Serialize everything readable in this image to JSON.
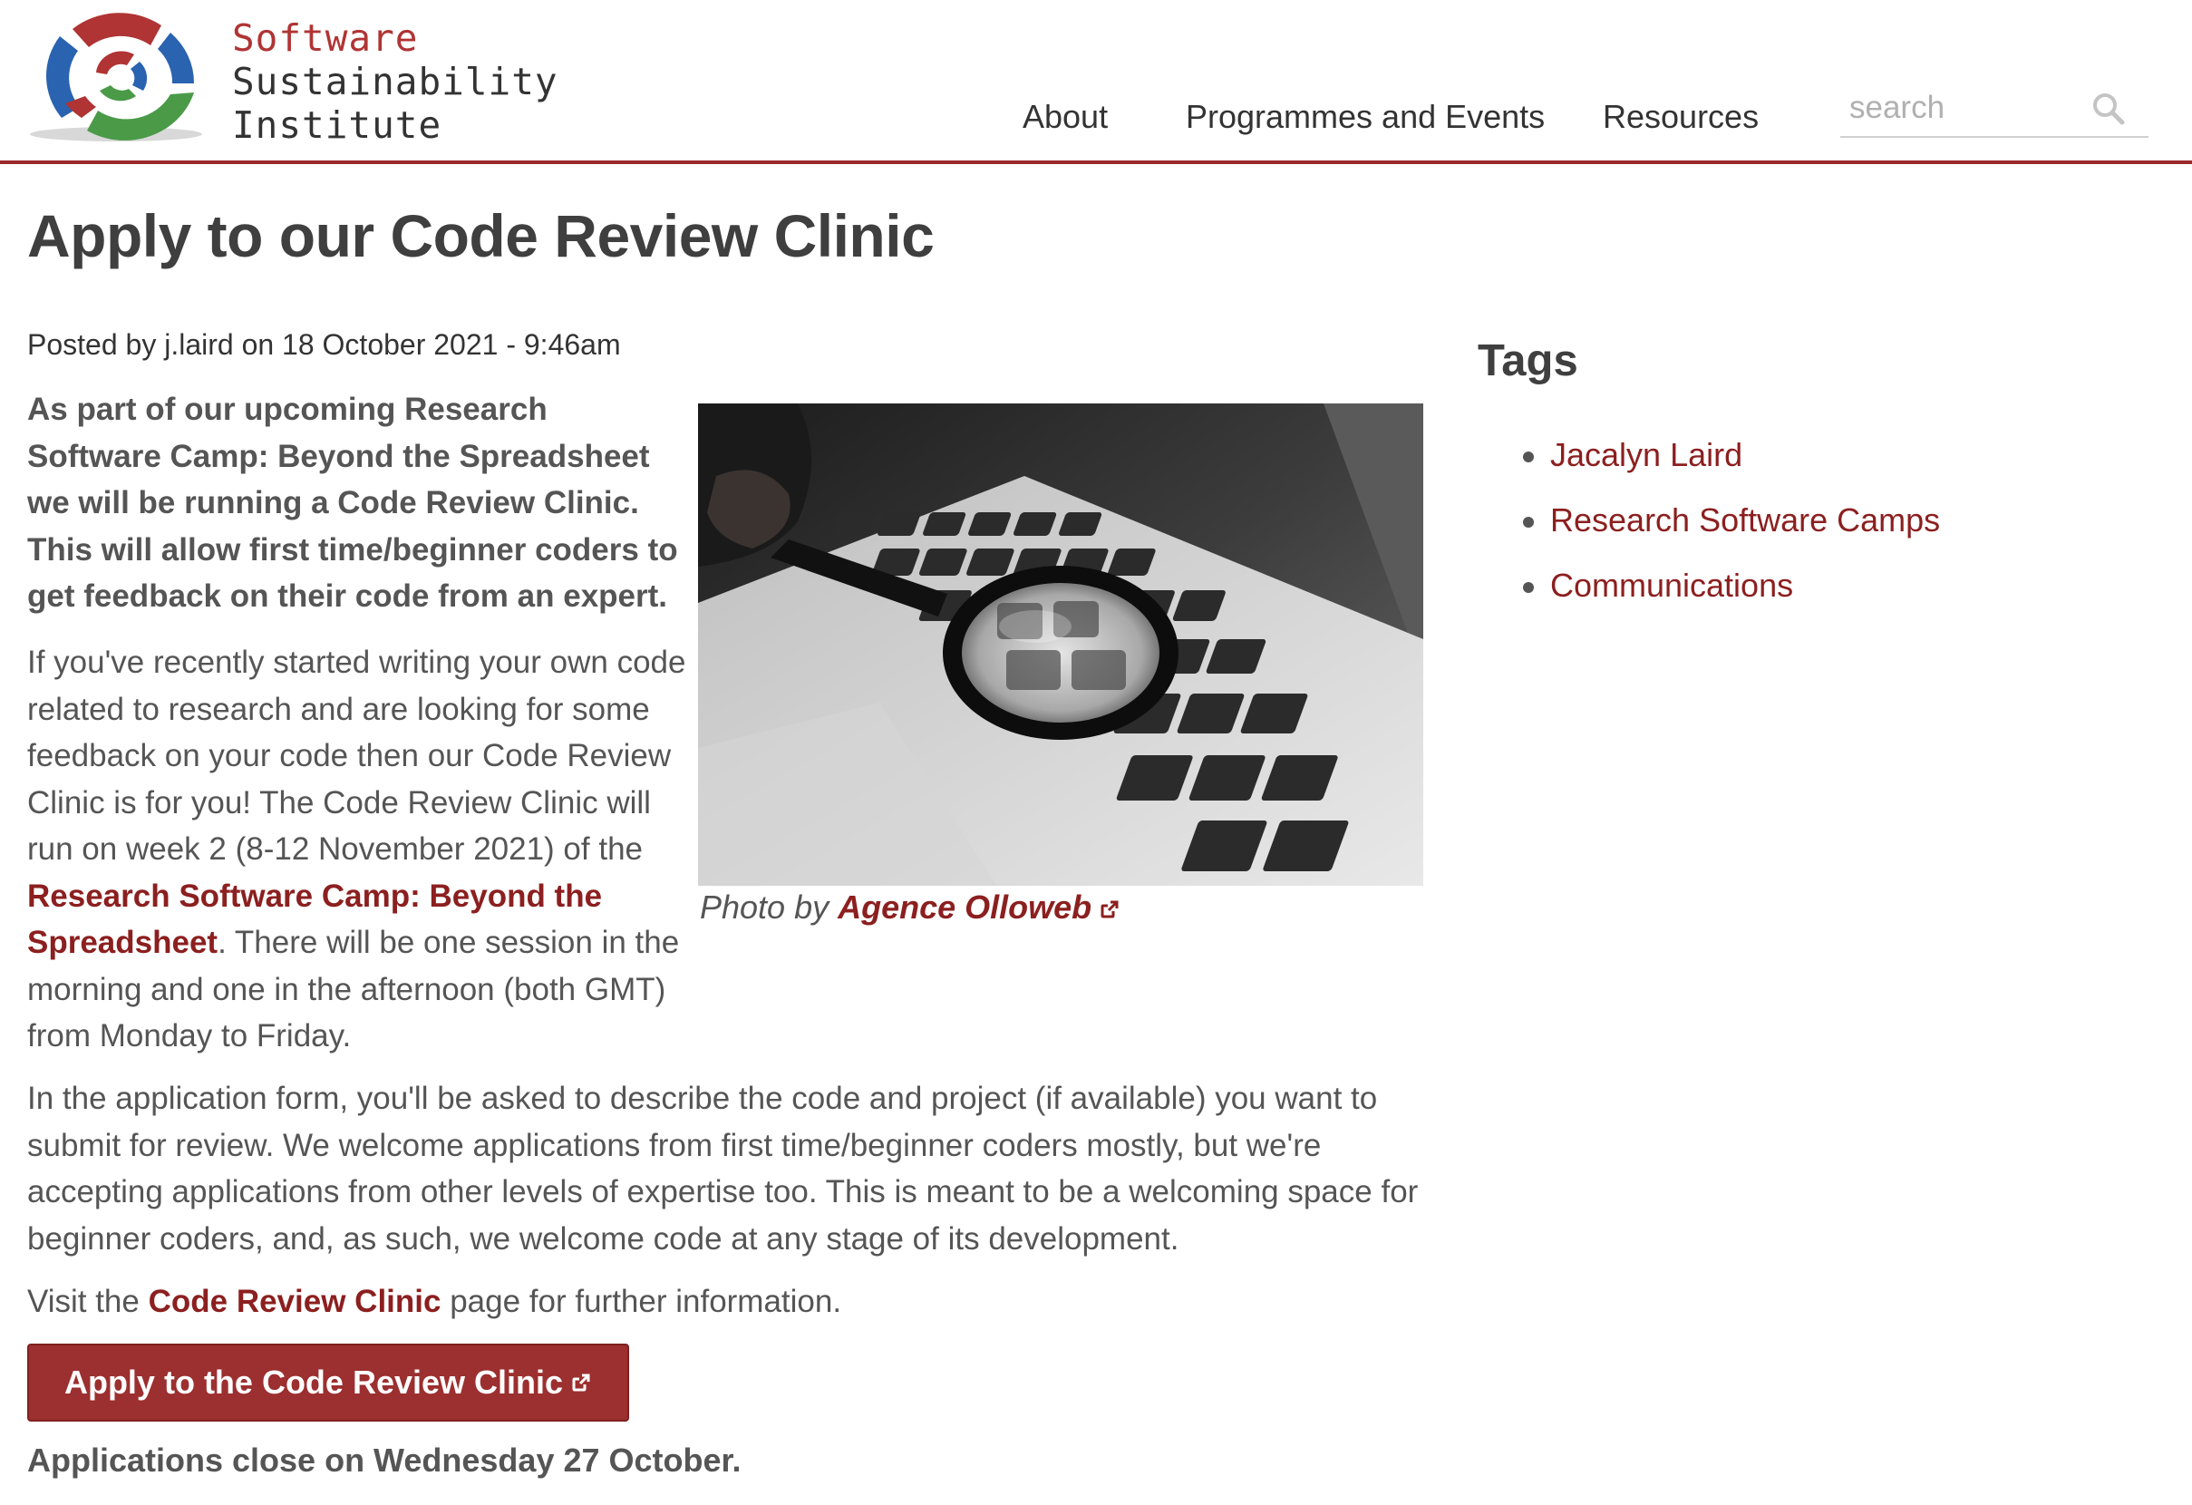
{
  "site": {
    "logo_lines": [
      "Software",
      "Sustainability",
      "Institute"
    ],
    "nav": [
      "About",
      "Programmes and Events",
      "Resources"
    ],
    "search_placeholder": "search"
  },
  "article": {
    "title": "Apply to our Code Review Clinic",
    "meta": "Posted by j.laird on 18 October 2021 - 9:46am",
    "lead": "As part of our upcoming Research Software Camp: Beyond the Spreadsheet we will be running a Code Review Clinic. This will allow first time/beginner coders to get feedback on their code from an expert.",
    "para1_before": "If you've recently started writing your own code related to research and are looking for some feedback on your code then our Code Review Clinic is for you! The Code Review Clinic will run on week 2 (8-12 November 2021) of the ",
    "para1_link": "Research Software Camp: Beyond the Spreadsheet",
    "para1_after": ". There will be one session in the morning and one in the afternoon (both GMT) from Monday to Friday.",
    "para2": "In the application form, you'll be asked to describe the code and project (if available) you want to submit for review. We welcome applications from first time/beginner coders mostly, but we're accepting applications from other levels of expertise too. This is meant to be a welcoming space for beginner coders, and, as such, we welcome code at any stage of its development.",
    "para3_before": "Visit the ",
    "para3_link": "Code Review Clinic",
    "para3_after": " page for further information.",
    "caption_prefix": "Photo by ",
    "caption_link": "Agence Olloweb",
    "apply_button": "Apply to the Code Review Clinic",
    "closing": "Applications close on Wednesday 27 October."
  },
  "sidebar": {
    "tags_title": "Tags",
    "tags": [
      "Jacalyn Laird",
      "Research Software Camps",
      "Communications"
    ]
  },
  "colors": {
    "brand_red": "#9c2a2a",
    "link": "#8c1f1f",
    "logo_blue": "#2a63b0",
    "logo_green": "#4a9a48",
    "logo_red": "#b03434"
  }
}
